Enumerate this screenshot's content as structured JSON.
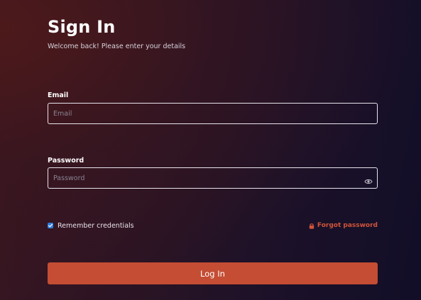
{
  "header": {
    "title": "Sign In",
    "subtitle": "Welcome back! Please enter your details"
  },
  "form": {
    "email": {
      "label": "Email",
      "placeholder": "Email",
      "value": ""
    },
    "password": {
      "label": "Password",
      "placeholder": "Password",
      "value": "",
      "toggle_icon": "eye-icon"
    },
    "remember": {
      "label": "Remember credentials",
      "checked": true
    },
    "forgot": {
      "label": "Forgot password",
      "icon": "lock-icon"
    },
    "submit_label": "Log In"
  },
  "colors": {
    "accent": "#c44d33",
    "link": "#d1533a",
    "checkbox": "#2f7de1",
    "background_start": "#3a1620",
    "background_end": "#120e27"
  }
}
